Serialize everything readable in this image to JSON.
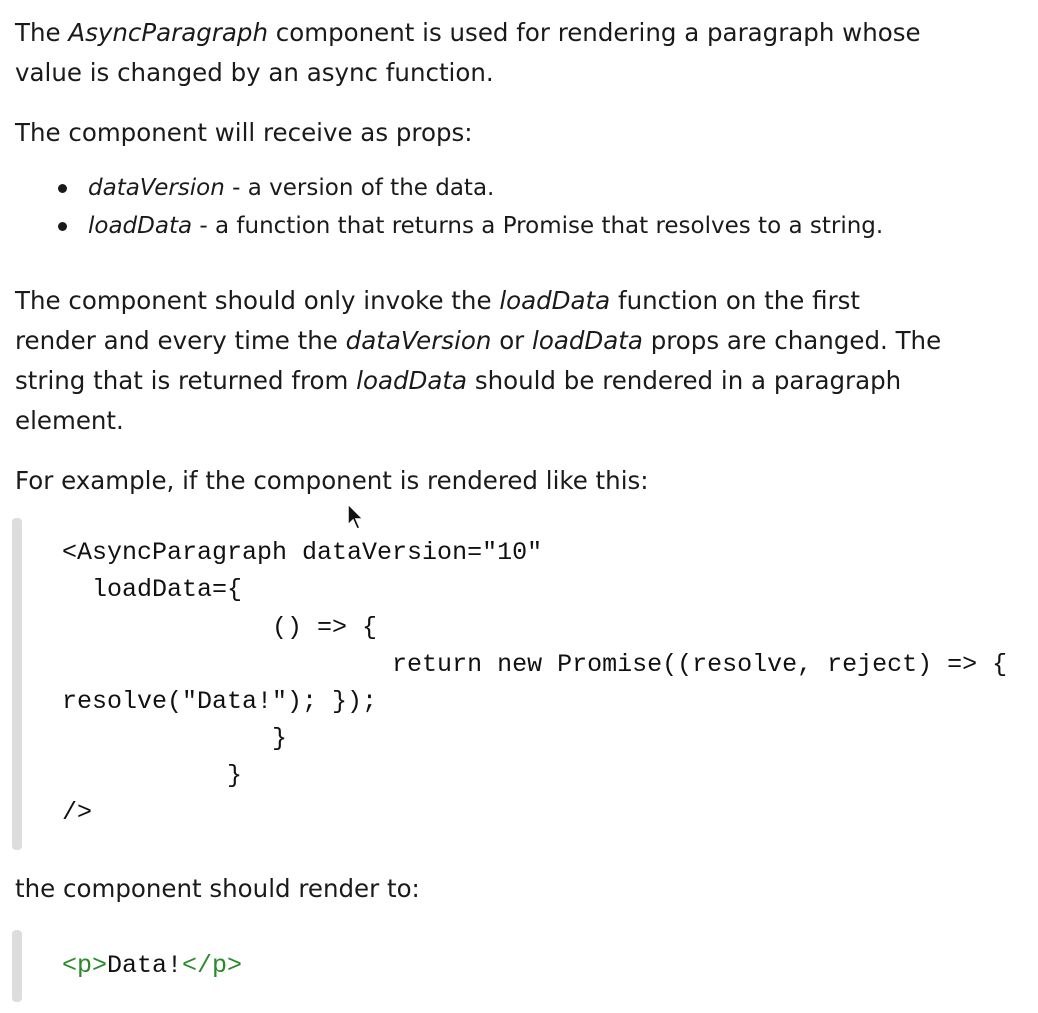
{
  "intro": {
    "pre": "The ",
    "em": "AsyncParagraph",
    "post": " component is used for rendering a paragraph whose",
    "line2": "value is changed by an async function."
  },
  "props_intro": "The component will receive as props:",
  "props": [
    {
      "name": "dataVersion",
      "desc": " - a version of the data."
    },
    {
      "name": "loadData",
      "desc": " - a function that returns a Promise that resolves to a string."
    }
  ],
  "requirement": {
    "l1_pre": "The component should only invoke the ",
    "l1_em": "loadData",
    "l1_post": " function on the first",
    "l2_pre": "render and every time the ",
    "l2_em1": "dataVersion",
    "l2_mid": " or ",
    "l2_em2": "loadData",
    "l2_post": " props are changed. The",
    "l3_pre": "string that is returned from ",
    "l3_em": "loadData",
    "l3_post": " should be rendered in a paragraph",
    "l4": "element."
  },
  "example_intro": "For example, if the component is rendered like this:",
  "code_lines": [
    "<AsyncParagraph dataVersion=\"10\"",
    "  loadData={",
    "              () => {",
    "                      return new Promise((resolve, reject) => {",
    "resolve(\"Data!\"); });",
    "              }",
    "           }",
    "/>"
  ],
  "render_intro": "the component should render to:",
  "output": {
    "open": "<p>",
    "text": "Data!",
    "close": "</p>"
  }
}
